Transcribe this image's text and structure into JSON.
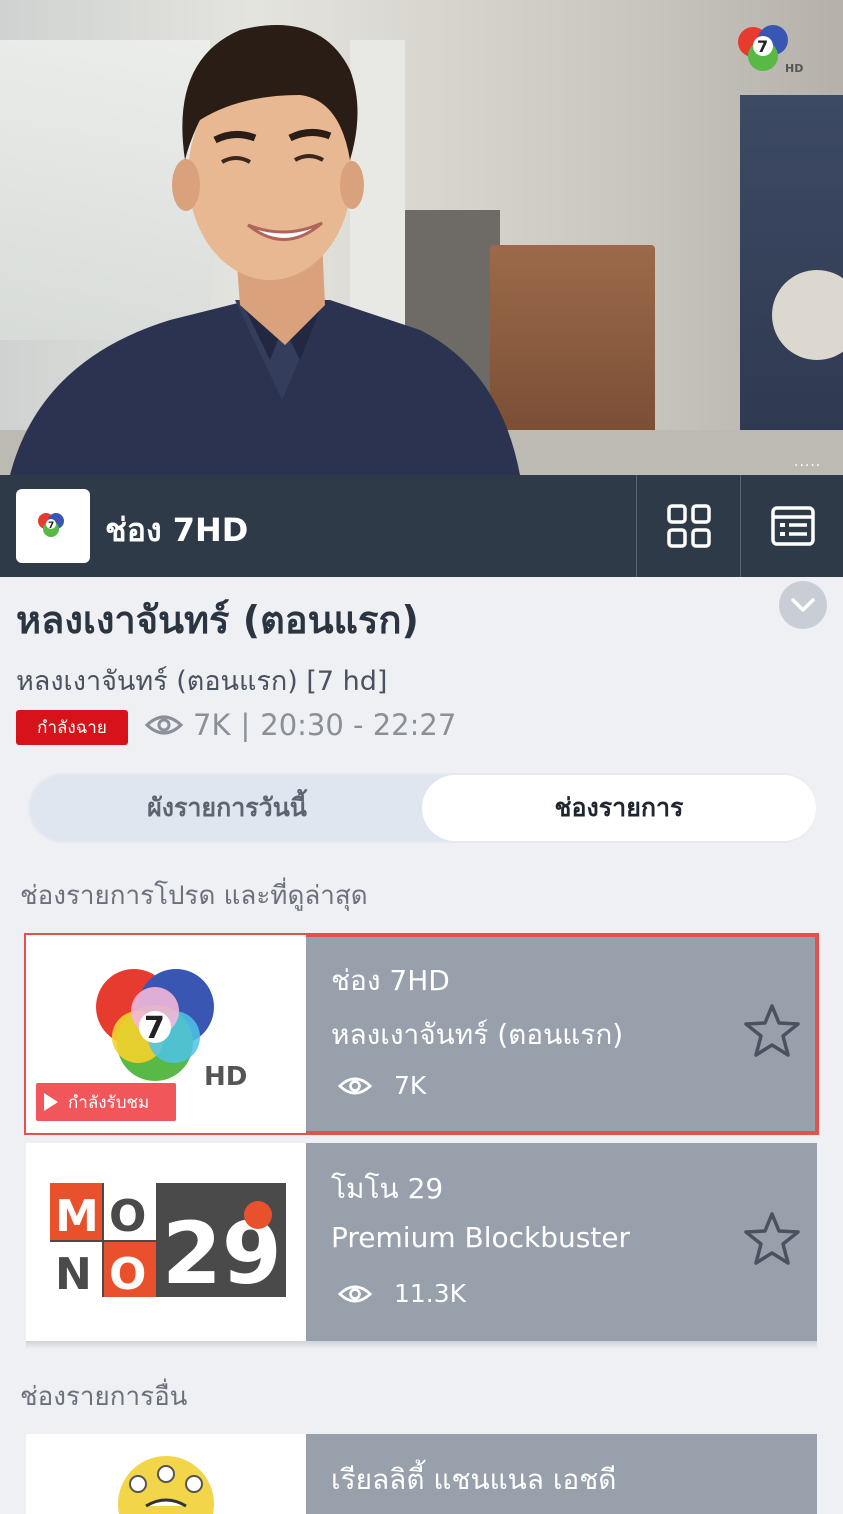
{
  "video": {
    "channel_watermark": "7 HD",
    "more_label": "....."
  },
  "channel_bar": {
    "channel_name": "ช่อง 7HD",
    "grid_icon": "grid-icon",
    "list_icon": "list-icon"
  },
  "program": {
    "title": "หลงเงาจันทร์ (ตอนแรก)",
    "subtitle": "หลงเงาจันทร์ (ตอนแรก) [7 hd]",
    "live_badge": "กำลังฉาย",
    "viewers": "7K",
    "separator": "|",
    "time_range": "20:30 - 22:27"
  },
  "tabs": [
    {
      "label": "ผังรายการวันนี้",
      "active": false
    },
    {
      "label": "ช่องรายการ",
      "active": true
    }
  ],
  "sections": {
    "favorites": "ช่องรายการโปรด และที่ดูล่าสุด",
    "others": "ช่องรายการอื่น"
  },
  "favorite_channels": [
    {
      "channel": "ช่อง 7HD",
      "program": "หลงเงาจันทร์ (ตอนแรก)",
      "views": "7K",
      "watching_label": "กำลังรับชม",
      "active": true
    },
    {
      "channel": "โมโน 29",
      "program": "Premium Blockbuster",
      "views": "11.3K",
      "active": false
    }
  ],
  "other_channels": [
    {
      "channel": "เรียลลิตี้ แชนแนล เอชดี"
    }
  ],
  "colors": {
    "bar": "#2f3a49",
    "live_red": "#d8121b",
    "card_gray": "#97a0ab",
    "active_outline": "#e2514f"
  }
}
